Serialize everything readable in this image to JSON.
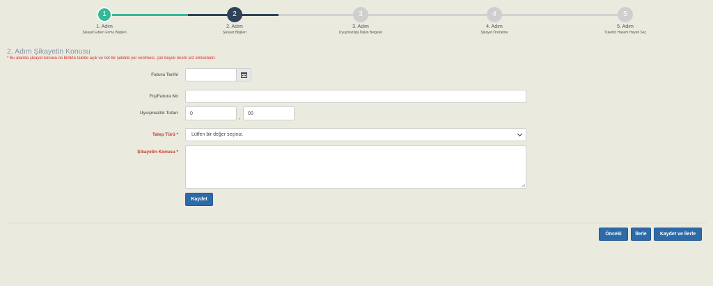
{
  "wizard": {
    "steps": [
      {
        "circle": "1",
        "num": "1. Adım",
        "label": "Şikayet Edilen Firma Bilgileri"
      },
      {
        "circle": "2",
        "num": "2. Adım",
        "label": "Şikayet Bilgileri"
      },
      {
        "circle": "3",
        "num": "3. Adım",
        "label": "Uyuşmazlığa İlişkin Belgeler"
      },
      {
        "circle": "4",
        "num": "4. Adım",
        "label": "Şikayet Önizleme"
      },
      {
        "circle": "5",
        "num": "5. Adım",
        "label": "Tüketici Hakem Heyeti Seç"
      }
    ],
    "colors": {
      "done": "#35b895",
      "active": "#2f4257",
      "pending": "#cfcfcf"
    }
  },
  "section": {
    "title": "2. Adım Şikayetin Konusu",
    "notice": "* Bu alanda şikayet konusu ile birlikte talebe açık ve net bir şekilde yer verilmesi, çok büyük önem arz etmektedir."
  },
  "form": {
    "invoice_date_label": "Fatura Tarihi",
    "invoice_date_value": "",
    "calendar_icon": "calendar-icon",
    "invoice_no_label": "Fiş/Fatura No",
    "invoice_no_value": "",
    "amount_label": "Uyuşmazlık Tutarı",
    "amount_whole": "0",
    "amount_separator": ",",
    "amount_fraction": "00",
    "request_type_label": "Talep Türü *",
    "request_type_value": "Lütfen bir değer seçiniz.",
    "subject_label": "Şikayetin Konusu *",
    "subject_value": "",
    "save_label": "Kaydet"
  },
  "footer": {
    "prev_label": "Önceki",
    "next_label": "İlerle",
    "save_next_label": "Kaydet ve İlerle"
  },
  "accent": "#2c6aa8",
  "required_color": "#c0392b"
}
